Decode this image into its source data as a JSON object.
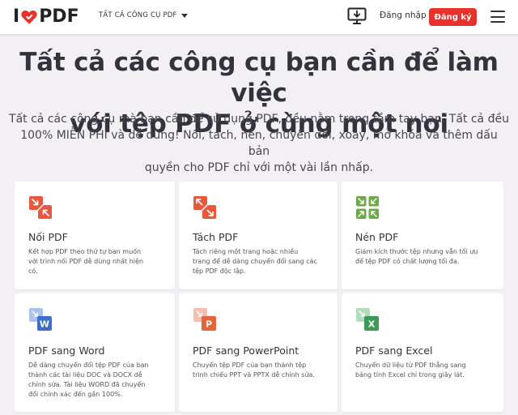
{
  "header": {
    "logo_left": "I",
    "logo_right": "PDF",
    "tools_menu_label": "TẤT CẢ CÔNG CỤ PDF",
    "login_label": "Đăng nhập",
    "signup_label": "Đăng ký"
  },
  "hero": {
    "title_line1": "Tất cả các công cụ bạn cần để làm việc",
    "title_line2": "với tệp PDF ở cùng một nơi",
    "subtitle_line1": "Tất cả các công cụ mà bạn cần để sử dụng PDF, đều nằm trong tầm tay bạn. Tất cả đều",
    "subtitle_line2": "100% MIỄN PHÍ và dễ dùng! Nối, tách, nén, chuyển đổi, xoay, mở khóa và thêm dấu bản",
    "subtitle_line3": "quyền cho PDF chỉ với một vài lần nhấp."
  },
  "tools": [
    {
      "title": "Nối PDF",
      "desc_lines": [
        "Kết hợp PDF theo thứ tự bạn muốn",
        "với trình nối PDF dễ dùng nhất hiện",
        "có."
      ],
      "icon": "merge-arrows-icon",
      "color": "#e5593f"
    },
    {
      "title": "Tách PDF",
      "desc_lines": [
        "Tách riêng một trang hoặc nhiều",
        "trang để dễ dàng chuyển đổi sang các",
        "tệp PDF độc lập."
      ],
      "icon": "split-arrows-icon",
      "color": "#e5593f"
    },
    {
      "title": "Nén PDF",
      "desc_lines": [
        "Giảm kích thước tệp nhưng vẫn tối ưu",
        "để tệp PDF có chất lượng tối đa."
      ],
      "icon": "compress-arrows-icon",
      "color": "#6fa84a"
    },
    {
      "title": "PDF sang Word",
      "desc_lines": [
        "Dễ dàng chuyển đổi tệp PDF của bạn",
        "thành các tài liệu DOC và DOCX dễ",
        "chỉnh sửa. Tài liệu WORD đã chuyển",
        "đổi chính xác đến gần 100%."
      ],
      "icon": "word-file-icon",
      "badge": "W",
      "color": "#3c6fc8",
      "color_light": "#a9c3ea"
    },
    {
      "title": "PDF sang PowerPoint",
      "desc_lines": [
        "Chuyển tệp PDF của bạn thành tệp",
        "trình chiếu PPT và PPTX dễ chỉnh sửa."
      ],
      "icon": "powerpoint-file-icon",
      "badge": "P",
      "color": "#e8643c",
      "color_light": "#f4c0ad"
    },
    {
      "title": "PDF sang Excel",
      "desc_lines": [
        "Chuyển dữ liệu từ PDF thẳng sang",
        "bảng tính Excel chỉ trong giây lát."
      ],
      "icon": "excel-file-icon",
      "badge": "X",
      "color": "#3f9a55",
      "color_light": "#b3dcbd"
    }
  ],
  "brand_color": "#e5322d"
}
